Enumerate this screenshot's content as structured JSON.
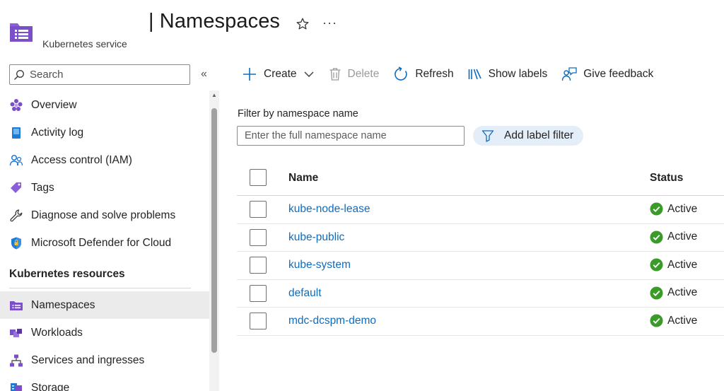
{
  "header": {
    "title": "| Namespaces",
    "service": "Kubernetes service",
    "more_label": "···"
  },
  "sidebar": {
    "search_placeholder": "Search",
    "collapse_label": "«",
    "items": [
      {
        "label": "Overview",
        "icon": "overview-icon"
      },
      {
        "label": "Activity log",
        "icon": "activity-log-icon"
      },
      {
        "label": "Access control (IAM)",
        "icon": "access-control-icon"
      },
      {
        "label": "Tags",
        "icon": "tag-icon"
      },
      {
        "label": "Diagnose and solve problems",
        "icon": "wrench-icon"
      },
      {
        "label": "Microsoft Defender for Cloud",
        "icon": "shield-icon"
      }
    ],
    "section_title": "Kubernetes resources",
    "resource_items": [
      {
        "label": "Namespaces",
        "icon": "namespaces-icon",
        "active": true
      },
      {
        "label": "Workloads",
        "icon": "workloads-icon"
      },
      {
        "label": "Services and ingresses",
        "icon": "network-icon"
      },
      {
        "label": "Storage",
        "icon": "storage-icon"
      }
    ]
  },
  "toolbar": {
    "create": "Create",
    "delete": "Delete",
    "refresh": "Refresh",
    "show_labels": "Show labels",
    "give_feedback": "Give feedback"
  },
  "filter": {
    "label": "Filter by namespace name",
    "placeholder": "Enter the full namespace name",
    "add_label_filter": "Add label filter"
  },
  "table": {
    "columns": {
      "name": "Name",
      "status": "Status"
    },
    "rows": [
      {
        "name": "kube-node-lease",
        "status": "Active"
      },
      {
        "name": "kube-public",
        "status": "Active"
      },
      {
        "name": "kube-system",
        "status": "Active"
      },
      {
        "name": "default",
        "status": "Active"
      },
      {
        "name": "mdc-dcspm-demo",
        "status": "Active"
      }
    ]
  },
  "colors": {
    "accent": "#0f6cbd",
    "success": "#3a9b29",
    "purple": "#7b4fc9",
    "active_bg": "#ebebeb"
  }
}
